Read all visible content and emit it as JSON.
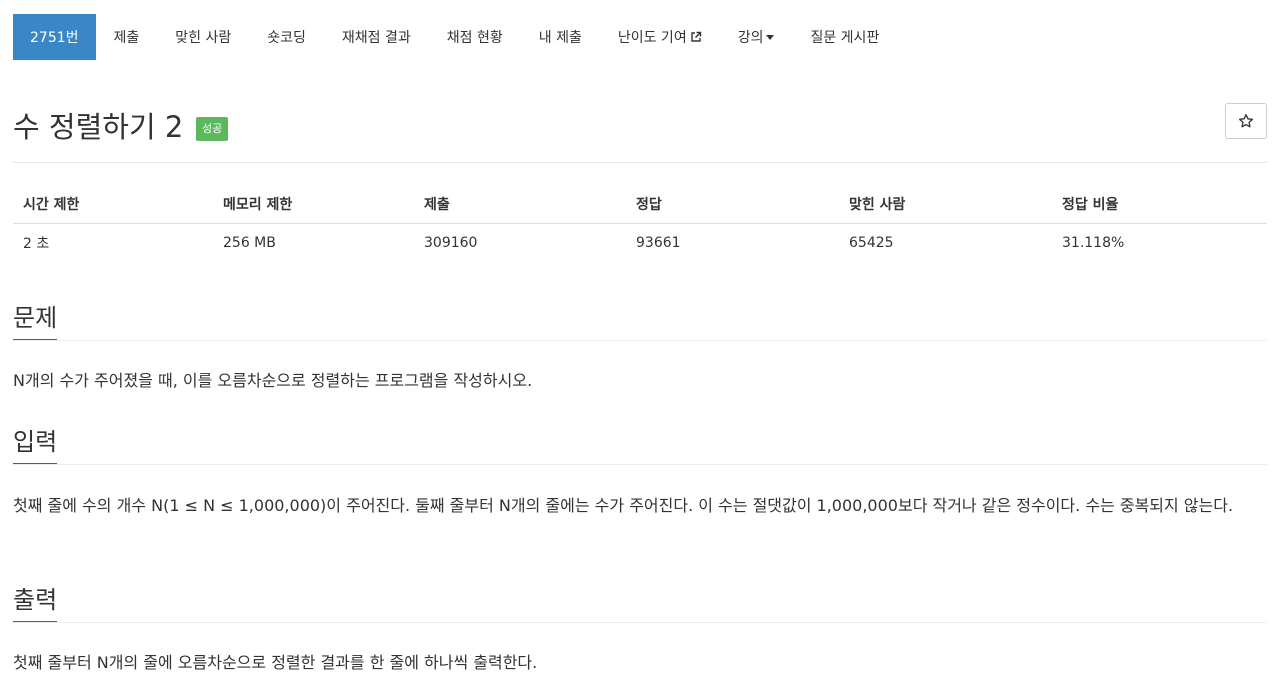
{
  "nav": {
    "problem_number": "2751번",
    "submit": "제출",
    "solved": "맞힌 사람",
    "shortest": "숏코딩",
    "rejudge": "재채점 결과",
    "status": "채점 현황",
    "my_submissions": "내 제출",
    "difficulty": "난이도 기여",
    "lecture": "강의",
    "board": "질문 게시판"
  },
  "problem": {
    "title": "수 정렬하기 2",
    "result_badge": "성공",
    "star_icon": "star-icon"
  },
  "info_table": {
    "headers": [
      "시간 제한",
      "메모리 제한",
      "제출",
      "정답",
      "맞힌 사람",
      "정답 비율"
    ],
    "values": [
      "2 초",
      "256 MB",
      "309160",
      "93661",
      "65425",
      "31.118%"
    ]
  },
  "sections": {
    "description_title": "문제",
    "description_text": "N개의 수가 주어졌을 때, 이를 오름차순으로 정렬하는 프로그램을 작성하시오.",
    "input_title": "입력",
    "input_text": "첫째 줄에 수의 개수 N(1 ≤ N ≤ 1,000,000)이 주어진다. 둘째 줄부터 N개의 줄에는 수가 주어진다. 이 수는 절댓값이 1,000,000보다 작거나 같은 정수이다. 수는 중복되지 않는다.",
    "output_title": "출력",
    "output_text": "첫째 줄부터 N개의 줄에 오름차순으로 정렬한 결과를 한 줄에 하나씩 출력한다."
  },
  "colors": {
    "nav_active": "#3a87c8",
    "badge_success": "#5cb85c",
    "section_underline": "#0076c0"
  }
}
